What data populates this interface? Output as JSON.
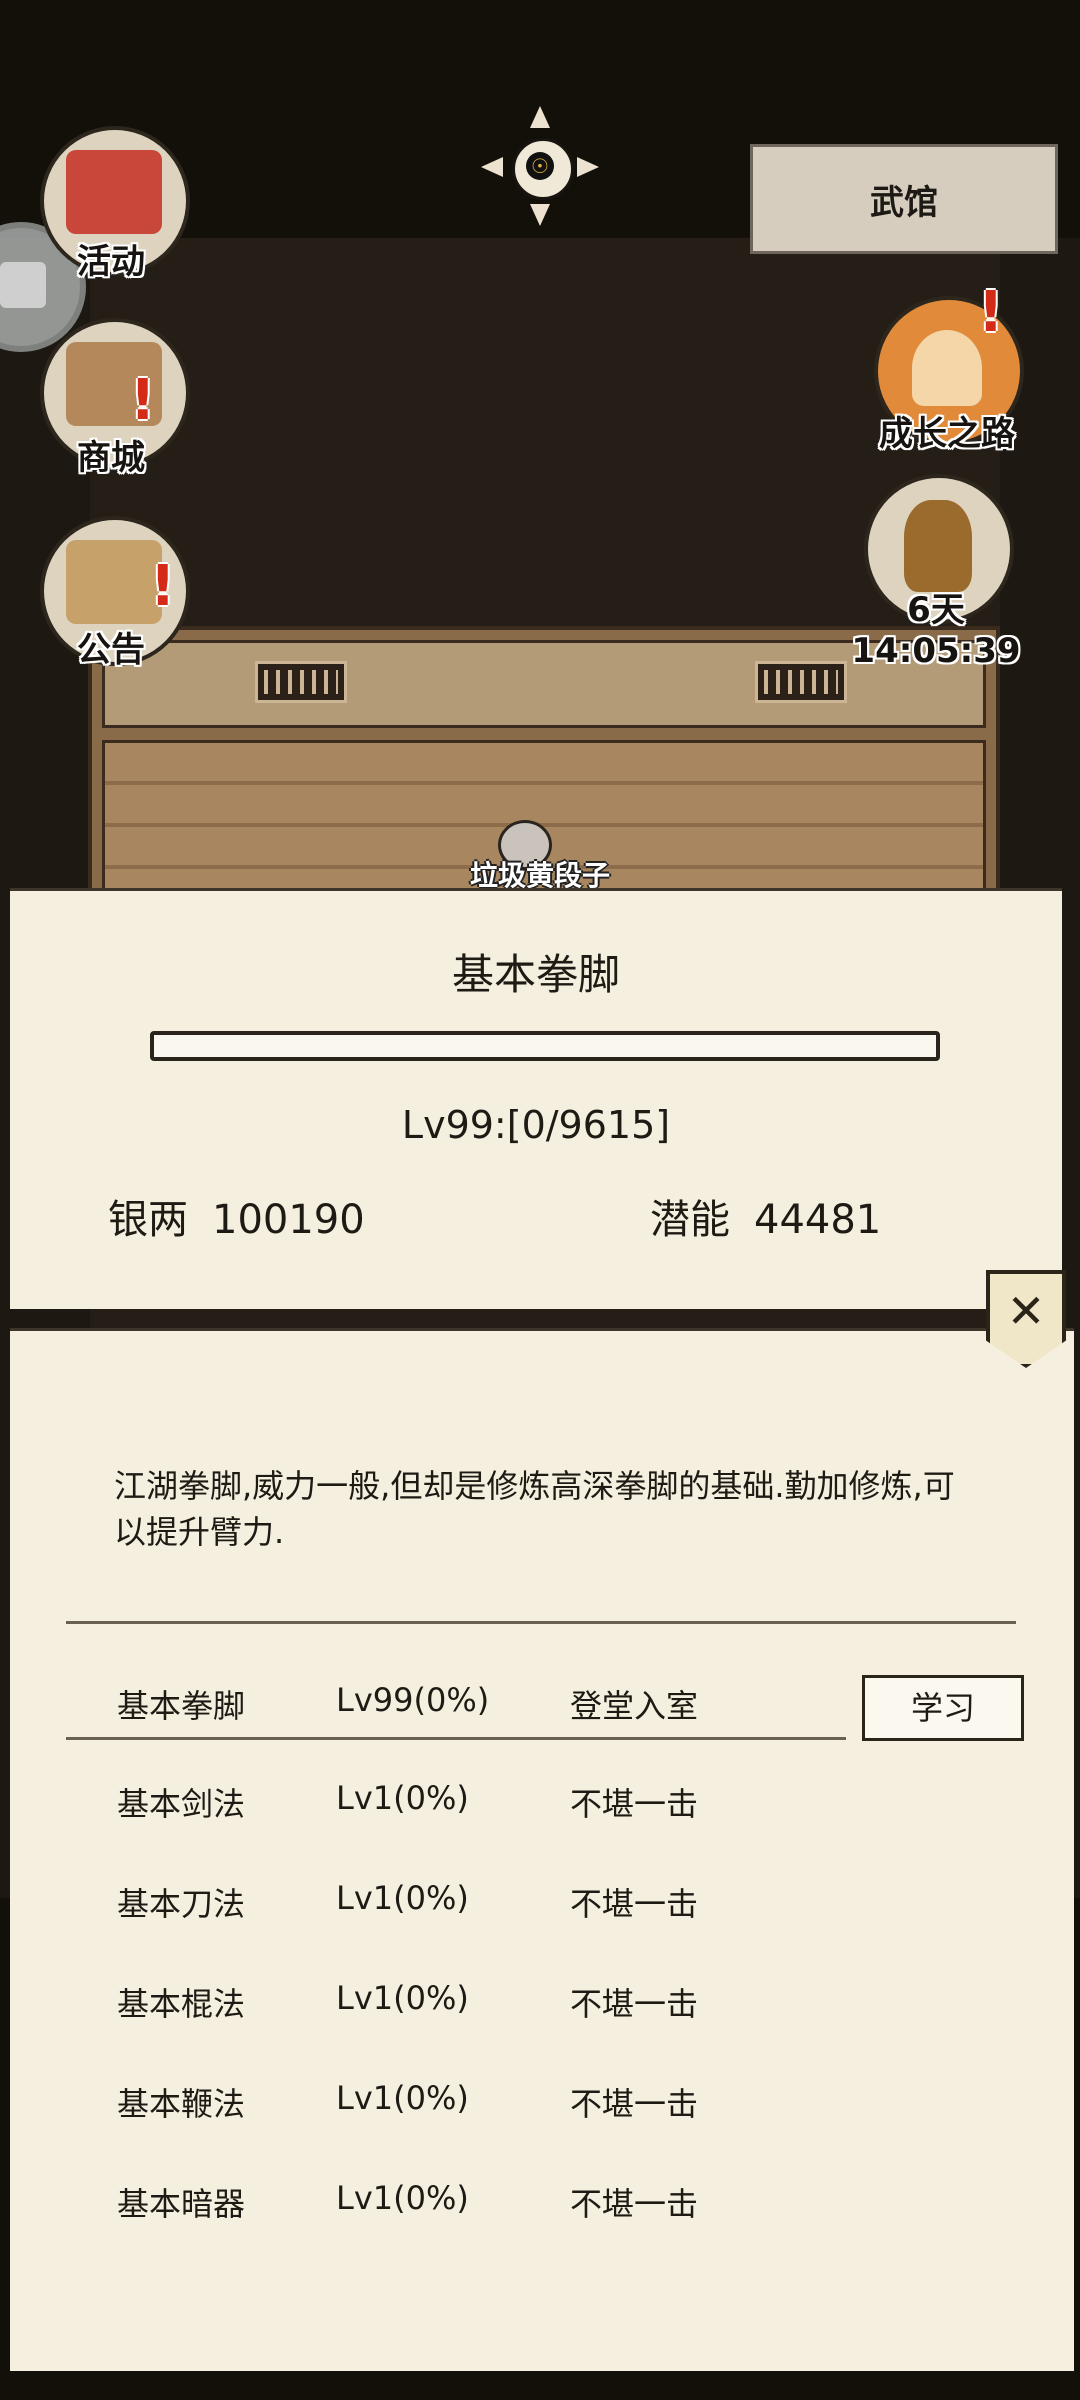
{
  "top": {
    "place_button": "武馆"
  },
  "left_menu": [
    {
      "label": "活动",
      "icon": "activity-banner-icon",
      "alert": false
    },
    {
      "label": "商城",
      "icon": "shop-stall-icon",
      "alert": true
    },
    {
      "label": "公告",
      "icon": "notice-board-icon",
      "alert": true
    }
  ],
  "right_menu": {
    "growth_label": "成长之路",
    "event_timer": "6天14:05:39"
  },
  "alert_mark": "!",
  "npc": {
    "name": "垃圾黄段子"
  },
  "skill_panel": {
    "title": "基本拳脚",
    "progress_fraction": 0,
    "level_text": "Lv99:[0/9615]",
    "silver_label": "银两",
    "silver_value": "100190",
    "potential_label": "潜能",
    "potential_value": "44481"
  },
  "detail_panel": {
    "close_symbol": "✕",
    "description": "江湖拳脚,威力一般,但却是修炼高深拳脚的基础.勤加修炼,可以提升臂力.",
    "learn_button": "学习",
    "skills": [
      {
        "name": "基本拳脚",
        "level": "Lv99(0%)",
        "rank": "登堂入室"
      },
      {
        "name": "基本剑法",
        "level": "Lv1(0%)",
        "rank": "不堪一击"
      },
      {
        "name": "基本刀法",
        "level": "Lv1(0%)",
        "rank": "不堪一击"
      },
      {
        "name": "基本棍法",
        "level": "Lv1(0%)",
        "rank": "不堪一击"
      },
      {
        "name": "基本鞭法",
        "level": "Lv1(0%)",
        "rank": "不堪一击"
      },
      {
        "name": "基本暗器",
        "level": "Lv1(0%)",
        "rank": "不堪一击"
      }
    ]
  },
  "colors": {
    "panel_bg": "#f5efdf",
    "alert": "#d32b17",
    "dark_bg": "#130f09"
  }
}
